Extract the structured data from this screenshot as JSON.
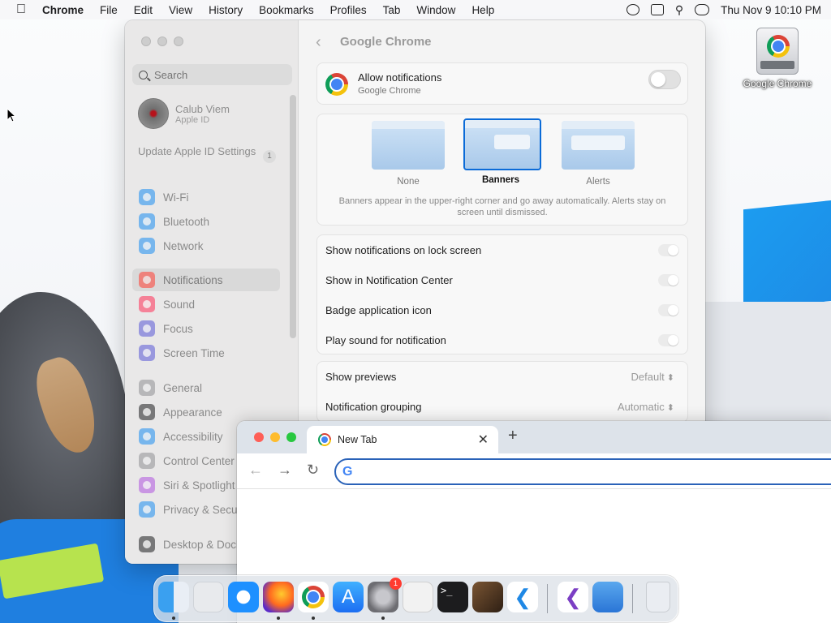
{
  "menubar": {
    "app_name": "Chrome",
    "menus": [
      "File",
      "Edit",
      "View",
      "History",
      "Bookmarks",
      "Profiles",
      "Tab",
      "Window",
      "Help"
    ],
    "datetime": "Thu Nov 9  10:10 PM"
  },
  "desktop": {
    "drive_label": "Google Chrome"
  },
  "settings": {
    "search_placeholder": "Search",
    "profile": {
      "name": "Calub Viem",
      "subtitle": "Apple ID"
    },
    "update": {
      "label": "Update Apple ID Settings",
      "count": "1"
    },
    "sidebar_items": [
      {
        "label": "Wi-Fi",
        "icon": "wifi-icon",
        "color": "#1a8cf0"
      },
      {
        "label": "Bluetooth",
        "icon": "bluetooth-icon",
        "color": "#1a8cf0"
      },
      {
        "label": "Network",
        "icon": "globe-icon",
        "color": "#1a8cf0"
      },
      {
        "label": "Notifications",
        "icon": "bell-icon",
        "color": "#ff3b30",
        "active": true
      },
      {
        "label": "Sound",
        "icon": "speaker-icon",
        "color": "#ff2d55"
      },
      {
        "label": "Focus",
        "icon": "moon-icon",
        "color": "#5856d6"
      },
      {
        "label": "Screen Time",
        "icon": "hourglass-icon",
        "color": "#5856d6"
      },
      {
        "label": "General",
        "icon": "gear-icon",
        "color": "#8e8e93"
      },
      {
        "label": "Appearance",
        "icon": "appearance-icon",
        "color": "#1c1c1e"
      },
      {
        "label": "Accessibility",
        "icon": "accessibility-icon",
        "color": "#1a8cf0"
      },
      {
        "label": "Control Center",
        "icon": "control-center-icon",
        "color": "#8e8e93"
      },
      {
        "label": "Siri & Spotlight",
        "icon": "siri-icon",
        "color": "#af52de"
      },
      {
        "label": "Privacy & Security",
        "icon": "hand-icon",
        "color": "#1a8cf0"
      },
      {
        "label": "Desktop & Dock",
        "icon": "dock-icon",
        "color": "#1c1c1e"
      }
    ],
    "content": {
      "title": "Google Chrome",
      "allow": {
        "title": "Allow notifications",
        "subtitle": "Google Chrome",
        "enabled": false
      },
      "alert_styles": [
        {
          "label": "None",
          "selected": false
        },
        {
          "label": "Banners",
          "selected": true
        },
        {
          "label": "Alerts",
          "selected": false
        }
      ],
      "style_description": "Banners appear in the upper-right corner and go away automatically. Alerts stay on screen until dismissed.",
      "toggles": [
        "Show notifications on lock screen",
        "Show in Notification Center",
        "Badge application icon",
        "Play sound for notification"
      ],
      "selects": [
        {
          "label": "Show previews",
          "value": "Default"
        },
        {
          "label": "Notification grouping",
          "value": "Automatic"
        }
      ]
    }
  },
  "chrome": {
    "tab_title": "New Tab",
    "new_tab_symbol": "+",
    "close_symbol": "✕",
    "omnibox_value": "",
    "traffic_colors": [
      "#fe5f57",
      "#febc2e",
      "#28c840"
    ]
  },
  "dock": {
    "apps": [
      {
        "name": "finder-icon",
        "color": "#3aa0f0",
        "running": true
      },
      {
        "name": "launchpad-icon",
        "color": "#e8eaed",
        "running": false
      },
      {
        "name": "safari-icon",
        "color": "#1e90ff",
        "running": false
      },
      {
        "name": "firefox-icon",
        "color": "#5b2bc8",
        "running": true
      },
      {
        "name": "chrome-icon",
        "color": "#ffffff",
        "running": true
      },
      {
        "name": "app-store-icon",
        "color": "#1c8ef9",
        "running": false
      },
      {
        "name": "system-settings-icon",
        "color": "#8e8e93",
        "running": true,
        "badge": "1"
      },
      {
        "name": "textedit-icon",
        "color": "#f2f2f2",
        "running": false
      },
      {
        "name": "terminal-icon",
        "color": "#1c1c1e",
        "running": false
      },
      {
        "name": "garageband-icon",
        "color": "#4a3526",
        "running": false
      },
      {
        "name": "vscode-icon",
        "color": "#ffffff",
        "running": false
      },
      {
        "name": "visual-studio-icon",
        "color": "#ffffff",
        "running": false
      },
      {
        "name": "weather-icon",
        "color": "#3d8fe0",
        "running": false
      },
      {
        "name": "trash-icon",
        "color": "#eceff3",
        "running": false
      }
    ]
  }
}
